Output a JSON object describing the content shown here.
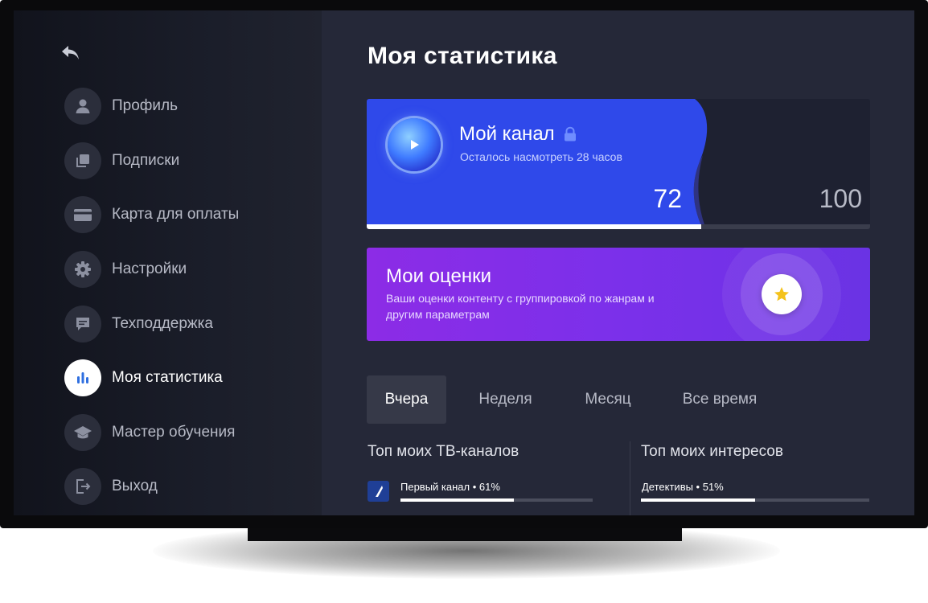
{
  "sidebar": {
    "back_icon": "back-arrow-icon",
    "items": [
      {
        "label": "Профиль",
        "icon": "user-icon",
        "active": false
      },
      {
        "label": "Подписки",
        "icon": "subscriptions-icon",
        "active": false
      },
      {
        "label": "Карта для оплаты",
        "icon": "credit-card-icon",
        "active": false
      },
      {
        "label": "Настройки",
        "icon": "gear-icon",
        "active": false
      },
      {
        "label": "Техподдержка",
        "icon": "chat-icon",
        "active": false
      },
      {
        "label": "Моя статистика",
        "icon": "bar-chart-icon",
        "active": true
      },
      {
        "label": "Мастер обучения",
        "icon": "graduation-cap-icon",
        "active": false
      },
      {
        "label": "Выход",
        "icon": "logout-icon",
        "active": false
      }
    ]
  },
  "main": {
    "title": "Моя статистика",
    "channel_card": {
      "title": "Мой канал",
      "subtitle": "Осталось насмотреть 28 часов",
      "value": "72",
      "max": "100",
      "progress_fraction": 0.665,
      "icon": "play-icon",
      "lock_icon": "lock-icon"
    },
    "ratings_card": {
      "title": "Мои оценки",
      "description": "Ваши оценки контенту с группировкой по жанрам и другим параметрам",
      "icon": "star-icon"
    },
    "tabs": [
      {
        "label": "Вчера",
        "active": true
      },
      {
        "label": "Неделя",
        "active": false
      },
      {
        "label": "Месяц",
        "active": false
      },
      {
        "label": "Все время",
        "active": false
      }
    ],
    "top_channels": {
      "title": "Топ моих ТВ-каналов",
      "items": [
        {
          "label": "Первый канал • 61%",
          "fraction": 0.59
        }
      ]
    },
    "top_interests": {
      "title": "Топ моих интересов",
      "items": [
        {
          "label": "Детективы • 51%",
          "fraction": 0.5
        }
      ]
    }
  },
  "colors": {
    "accent_blue": "#2f49ea",
    "accent_purple": "#7b30ea",
    "screen_bg": "#252838"
  }
}
